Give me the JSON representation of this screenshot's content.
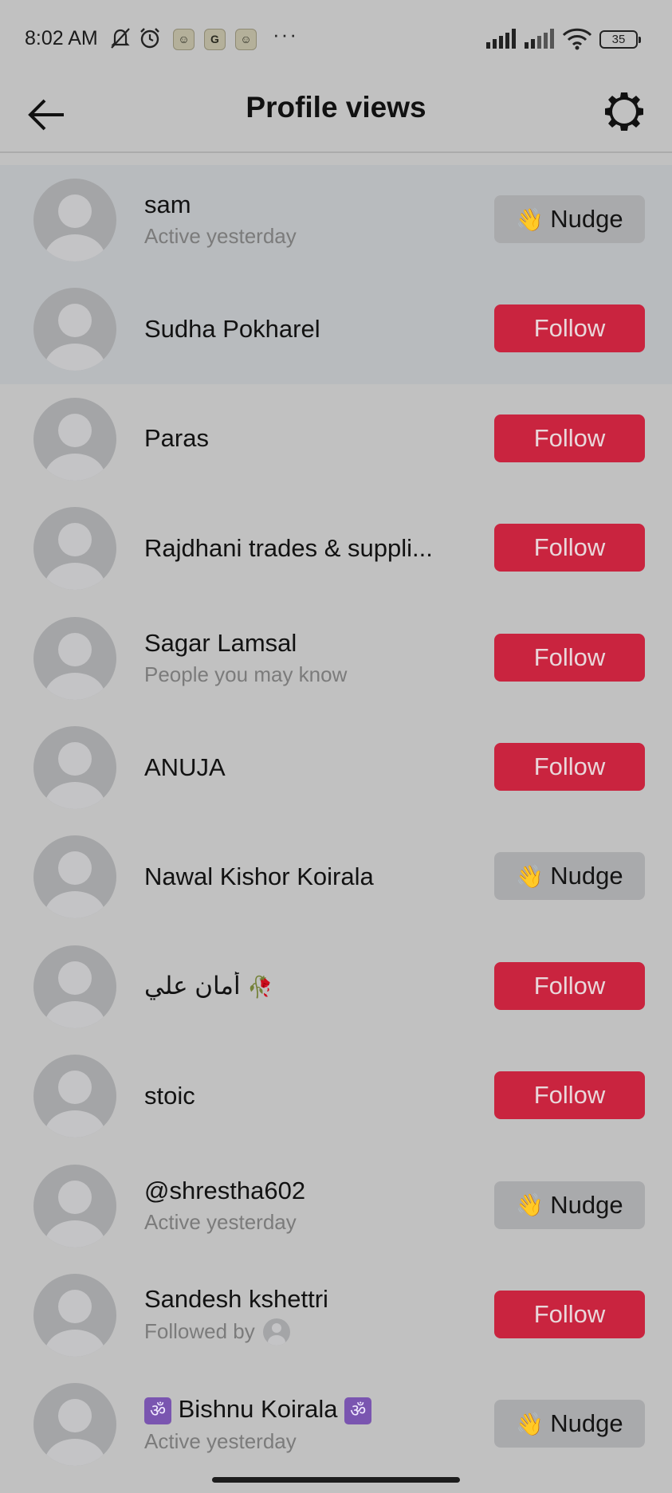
{
  "status_bar": {
    "time": "8:02 AM",
    "battery": "35",
    "more": "···",
    "icons": [
      "mute-bell-icon",
      "alarm-icon",
      "snapchat-icon",
      "google-icon",
      "snapchat-icon",
      "signal-icon",
      "signal-icon",
      "wifi-icon",
      "battery-icon"
    ],
    "app_glyphs": [
      "☺",
      "G",
      "☺"
    ]
  },
  "header": {
    "title": "Profile views",
    "back_icon": "arrow-left-icon",
    "settings_icon": "gear-icon"
  },
  "colors": {
    "follow_bg": "#c9243f",
    "follow_text": "#e9d7da",
    "nudge_bg": "#a9aaac",
    "highlight": "#b8bbbe",
    "background": "#c1c1c1"
  },
  "buttons": {
    "follow": "Follow",
    "nudge": "Nudge",
    "nudge_icon": "👋"
  },
  "rows": [
    {
      "name": "sam",
      "sub": "Active yesterday",
      "action": "Nudge"
    },
    {
      "name": "Sudha Pokharel",
      "sub": "",
      "action": "Follow"
    },
    {
      "name": "Paras",
      "sub": "",
      "action": "Follow"
    },
    {
      "name": "Rajdhani trades & suppli...",
      "sub": "",
      "action": "Follow"
    },
    {
      "name": "Sagar Lamsal",
      "sub": "People you may know",
      "action": "Follow"
    },
    {
      "name": "ANUJA",
      "sub": "",
      "action": "Follow"
    },
    {
      "name": "Nawal Kishor Koirala",
      "sub": "",
      "action": "Nudge"
    },
    {
      "name": "أمان علي",
      "name_suffix": "🥀",
      "sub": "",
      "action": "Follow"
    },
    {
      "name": "stoic",
      "sub": "",
      "action": "Follow"
    },
    {
      "name": "@shrestha602",
      "sub": "Active yesterday",
      "action": "Nudge"
    },
    {
      "name": "Sandesh kshettri",
      "sub": "Followed by",
      "action": "Follow"
    },
    {
      "name": "Bishnu Koirala",
      "name_prefix": "ॐ",
      "name_suffix": "ॐ",
      "sub": "Active yesterday",
      "action": "Nudge"
    }
  ]
}
